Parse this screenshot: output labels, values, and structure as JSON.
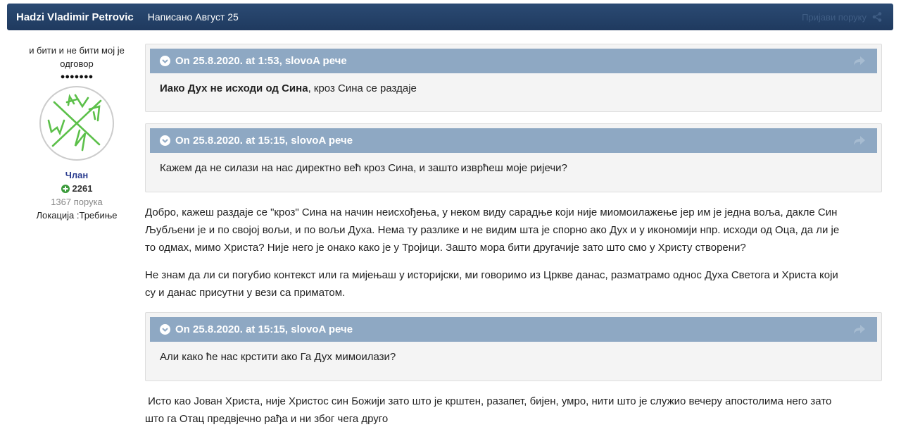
{
  "header": {
    "author": "Hadzi Vladimir Petrovic",
    "date": "Написано Август 25",
    "report": "Пријави поруку",
    "share_icon": "share-icon"
  },
  "sidebar": {
    "title_line1": "и бити и не бити мој је",
    "title_line2": "одговор",
    "pips": "●●●●●●●",
    "rank": "Члан",
    "reputation": "2261",
    "posts": "1367 порука",
    "location": "Локација :Требиње"
  },
  "quotes": [
    {
      "cite": "On 25.8.2020. at 1:53, slovoA рече",
      "bold": "Иако Дух не исходи од Сина",
      "text": ", кроз Сина се раздаје"
    },
    {
      "cite": "On 25.8.2020. at 15:15, slovoA рече",
      "text": "Кажем да не силази на нас директно већ кроз Сина, и зашто изврћеш моје ријечи?"
    },
    {
      "cite": "On 25.8.2020. at 15:15, slovoA рече",
      "text": "Али како ће нас крстити ако Га Дух мимоилази?"
    }
  ],
  "paragraphs": [
    {
      "line1": "Добро, кажеш раздаје се \"кроз\" Сина на начин неисхођења, у неком виду сарадње који није миомоилажење јер им је једна воља, дакле Син",
      "line2": "Љубљени је и по својој вољи, и по вољи Духа. Нема ту разлике и не видим шта је спорно ако Дух и у икономији нпр. исходи од Оца, да ли је",
      "line3": "то одмах, мимо Христа? Није него је онако како је у Тројици. Зашто мора бити другачије зато што смо у Христу створени?"
    },
    {
      "line1": "Не знам да ли си погубио контекст или га мијењаш у историјски, ми говоримо из Цркве данас, разматрамо однос Духа Светога и Христа који",
      "line2": "су и данас присутни у вези са приматом."
    },
    {
      "line1": " Исто као Јован Христа, није Христос син Божији зато што је крштен, разапет, бијен, умро, нити што је служио вечеру апостолима него зато",
      "line2": "што га Отац предвјечно рађа и ни због чега друго"
    }
  ],
  "colors": {
    "header_bg": "#1f3a5f",
    "quote_head_bg": "#8ea8c3",
    "rank_color": "#2a3c8f",
    "rep_green": "#3a9a3a"
  }
}
